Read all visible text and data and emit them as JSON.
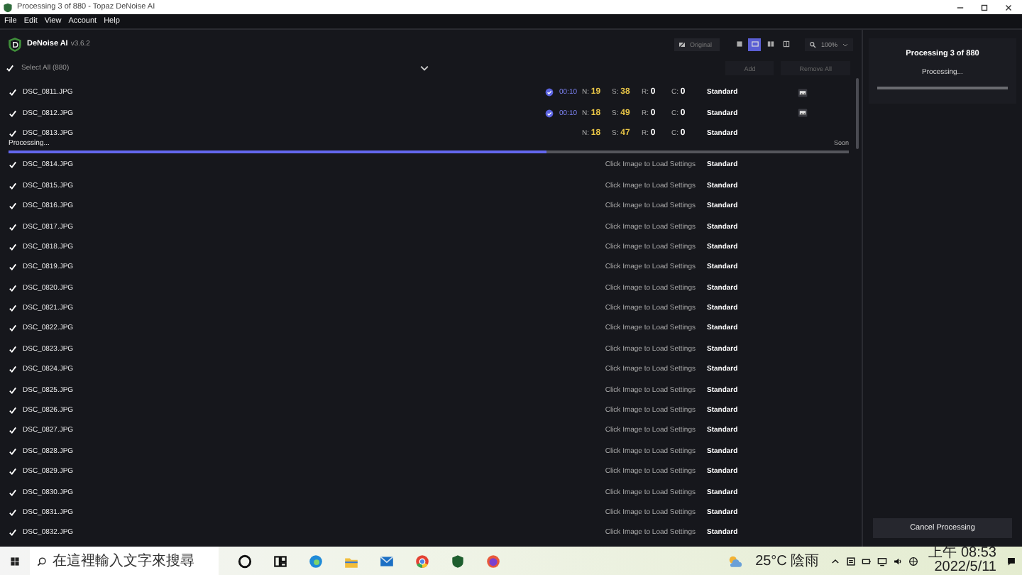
{
  "window": {
    "title": "Processing 3 of 880 - Topaz DeNoise AI"
  },
  "menu": [
    "File",
    "Edit",
    "View",
    "Account",
    "Help"
  ],
  "app": {
    "name": "DeNoise AI",
    "version": "v3.6.2"
  },
  "toolbar": {
    "original_label": "Original",
    "view_modes": [
      {
        "selected": false
      },
      {
        "selected": true
      },
      {
        "selected": false
      },
      {
        "selected": false
      }
    ],
    "zoom": "100%"
  },
  "select_all": {
    "label": "Select All (880)",
    "checked": true
  },
  "actions": [
    {
      "label": "Add",
      "disabled": true
    },
    {
      "label": "Remove All",
      "disabled": true
    }
  ],
  "files": [
    {
      "name": "DSC_0811.JPG",
      "checked": true,
      "kind": "done",
      "time": "00:10",
      "settings": [
        {
          "label": "N:",
          "value": "19",
          "color": "#e8c547"
        },
        {
          "label": "S:",
          "value": "38",
          "color": "#e8c547"
        },
        {
          "label": "R:",
          "value": "0",
          "color": "#ffffff"
        },
        {
          "label": "C:",
          "value": "0",
          "color": "#ffffff"
        }
      ],
      "model": "Standard"
    },
    {
      "name": "DSC_0812.JPG",
      "checked": true,
      "kind": "done",
      "time": "00:10",
      "settings": [
        {
          "label": "N:",
          "value": "18",
          "color": "#e8c547"
        },
        {
          "label": "S:",
          "value": "49",
          "color": "#e8c547"
        },
        {
          "label": "R:",
          "value": "0",
          "color": "#ffffff"
        },
        {
          "label": "C:",
          "value": "0",
          "color": "#ffffff"
        }
      ],
      "model": "Standard"
    },
    {
      "name": "DSC_0813.JPG",
      "checked": true,
      "kind": "processing",
      "settings": [
        {
          "label": "N:",
          "value": "18",
          "color": "#e8c547"
        },
        {
          "label": "S:",
          "value": "47",
          "color": "#e8c547"
        },
        {
          "label": "R:",
          "value": "0",
          "color": "#ffffff"
        },
        {
          "label": "C:",
          "value": "0",
          "color": "#ffffff"
        }
      ],
      "model": "Standard",
      "progress": {
        "label": "Processing...",
        "eta": "Soon",
        "level": 0.64
      }
    },
    {
      "name": "DSC_0814.JPG",
      "checked": true,
      "kind": "pending",
      "hint": "Click Image to Load Settings",
      "model": "Standard"
    },
    {
      "name": "DSC_0815.JPG",
      "checked": true,
      "kind": "pending",
      "hint": "Click Image to Load Settings",
      "model": "Standard"
    },
    {
      "name": "DSC_0816.JPG",
      "checked": true,
      "kind": "pending",
      "hint": "Click Image to Load Settings",
      "model": "Standard"
    },
    {
      "name": "DSC_0817.JPG",
      "checked": true,
      "kind": "pending",
      "hint": "Click Image to Load Settings",
      "model": "Standard"
    },
    {
      "name": "DSC_0818.JPG",
      "checked": true,
      "kind": "pending",
      "hint": "Click Image to Load Settings",
      "model": "Standard"
    },
    {
      "name": "DSC_0819.JPG",
      "checked": true,
      "kind": "pending",
      "hint": "Click Image to Load Settings",
      "model": "Standard"
    },
    {
      "name": "DSC_0820.JPG",
      "checked": true,
      "kind": "pending",
      "hint": "Click Image to Load Settings",
      "model": "Standard"
    },
    {
      "name": "DSC_0821.JPG",
      "checked": true,
      "kind": "pending",
      "hint": "Click Image to Load Settings",
      "model": "Standard"
    },
    {
      "name": "DSC_0822.JPG",
      "checked": true,
      "kind": "pending",
      "hint": "Click Image to Load Settings",
      "model": "Standard"
    },
    {
      "name": "DSC_0823.JPG",
      "checked": true,
      "kind": "pending",
      "hint": "Click Image to Load Settings",
      "model": "Standard"
    },
    {
      "name": "DSC_0824.JPG",
      "checked": true,
      "kind": "pending",
      "hint": "Click Image to Load Settings",
      "model": "Standard"
    },
    {
      "name": "DSC_0825.JPG",
      "checked": true,
      "kind": "pending",
      "hint": "Click Image to Load Settings",
      "model": "Standard"
    },
    {
      "name": "DSC_0826.JPG",
      "checked": true,
      "kind": "pending",
      "hint": "Click Image to Load Settings",
      "model": "Standard"
    },
    {
      "name": "DSC_0827.JPG",
      "checked": true,
      "kind": "pending",
      "hint": "Click Image to Load Settings",
      "model": "Standard"
    },
    {
      "name": "DSC_0828.JPG",
      "checked": true,
      "kind": "pending",
      "hint": "Click Image to Load Settings",
      "model": "Standard"
    },
    {
      "name": "DSC_0829.JPG",
      "checked": true,
      "kind": "pending",
      "hint": "Click Image to Load Settings",
      "model": "Standard"
    },
    {
      "name": "DSC_0830.JPG",
      "checked": true,
      "kind": "pending",
      "hint": "Click Image to Load Settings",
      "model": "Standard"
    },
    {
      "name": "DSC_0831.JPG",
      "checked": true,
      "kind": "pending",
      "hint": "Click Image to Load Settings",
      "model": "Standard"
    },
    {
      "name": "DSC_0832.JPG",
      "checked": true,
      "kind": "pending",
      "hint": "Click Image to Load Settings",
      "model": "Standard"
    }
  ],
  "panel": {
    "title": "Processing 3 of 880",
    "status": "Processing...",
    "level": 0,
    "button": "Cancel Processing"
  },
  "taskbar": {
    "search_placeholder": "在這裡輸入文字來搜尋",
    "weather": "25°C 陰雨",
    "time": "上午 08:53",
    "date": "2022/5/11"
  }
}
